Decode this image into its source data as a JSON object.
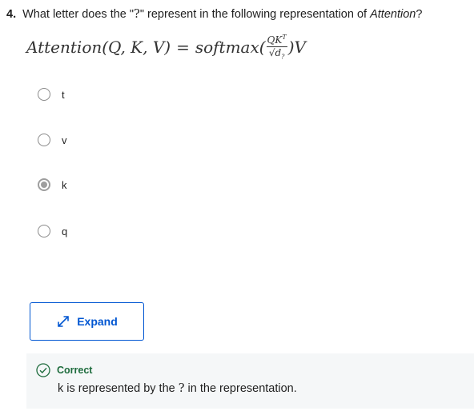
{
  "question": {
    "number": "4.",
    "text_before": "What letter does the \"",
    "symbol": "?",
    "text_middle": "\" represent in the following representation of ",
    "term": "Attention",
    "text_end": "?"
  },
  "formula": {
    "lhs": "Attention(Q, K, V)",
    "equals": "=",
    "fn": "softmax(",
    "numerator": "QK",
    "numerator_sup": "T",
    "denominator_root": "√d",
    "denominator_sub": "?",
    "close": ")V"
  },
  "options": [
    {
      "label": "t",
      "selected": false
    },
    {
      "label": "v",
      "selected": false
    },
    {
      "label": "k",
      "selected": true
    },
    {
      "label": "q",
      "selected": false
    }
  ],
  "expand_button": {
    "label": "Expand",
    "icon": "expand-arrows-icon"
  },
  "feedback": {
    "status": "Correct",
    "icon": "check-circle-icon",
    "text_before": "k is represented by the ",
    "symbol": "?",
    "text_after": " in the representation."
  },
  "colors": {
    "accent_blue": "#0056d2",
    "correct_green": "#1e6c3d",
    "feedback_bg": "#f5f7f8",
    "radio_selected": "#9e9e9e"
  }
}
